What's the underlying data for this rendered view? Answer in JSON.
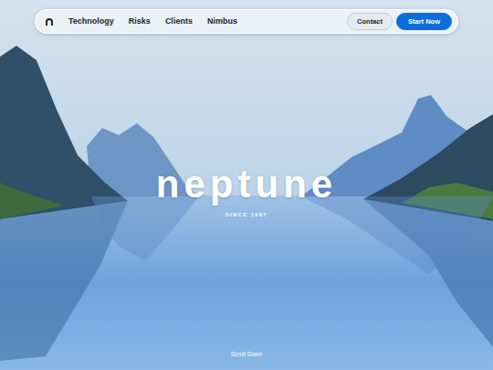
{
  "nav": {
    "links": [
      {
        "label": "Technology"
      },
      {
        "label": "Risks"
      },
      {
        "label": "Clients"
      },
      {
        "label": "Nimbus"
      }
    ],
    "buttons": [
      {
        "label": "Contact",
        "kind": "secondary"
      },
      {
        "label": "Start Now",
        "kind": "primary"
      }
    ]
  },
  "hero": {
    "title": "neptune",
    "subtitle": "SINCE 1987",
    "scroll_hint": "Scroll Down"
  }
}
